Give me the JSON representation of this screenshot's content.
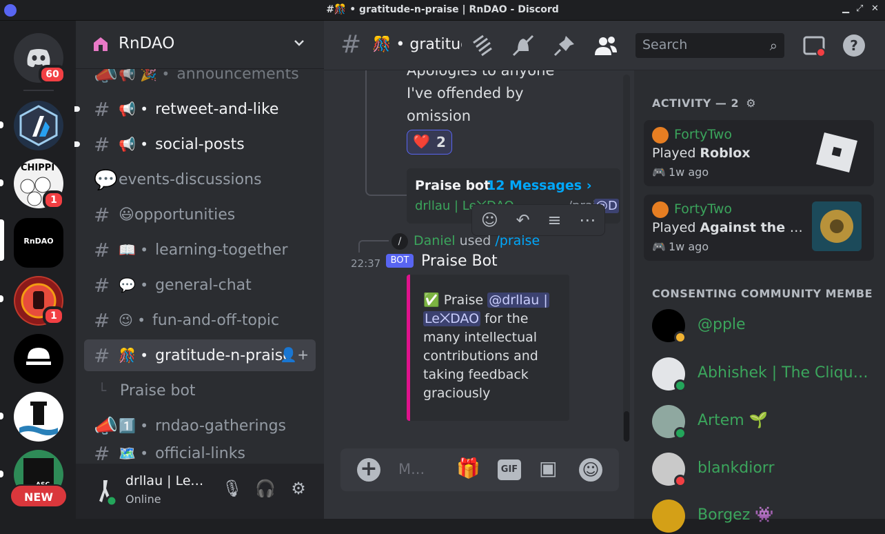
{
  "window": {
    "title": "#🎊 • gratitude-n-praise | RnDAO - Discord"
  },
  "guilds": {
    "home_badge": "60",
    "badges": [
      "1",
      "1"
    ],
    "rndao_label": "RnDAO",
    "new_label": "NEW",
    "chippi_label": "CHIPPI",
    "asc_label": "ASC"
  },
  "server": {
    "name": "RnDAO"
  },
  "channels": [
    {
      "prefix": "📢 🎉 •",
      "name": "announcements"
    },
    {
      "prefix": "📢 •",
      "name": "retweet-and-like"
    },
    {
      "prefix": "📢 •",
      "name": "social-posts"
    },
    {
      "prefix": "",
      "name": "events-discussions"
    },
    {
      "prefix": "😃",
      "name": "opportunities"
    },
    {
      "prefix": "📖 •",
      "name": "learning-together"
    },
    {
      "prefix": "💬 •",
      "name": "general-chat"
    },
    {
      "prefix": "😉 •",
      "name": "fun-and-off-topic"
    },
    {
      "prefix": "🎊 •",
      "name": "gratitude-n-praise"
    },
    {
      "prefix": "",
      "name": "Praise bot"
    },
    {
      "prefix": "1️⃣ •",
      "name": "rndao-gatherings"
    },
    {
      "prefix": "🗺️ •",
      "name": "official-links"
    }
  ],
  "user": {
    "name": "drllau | Lex...",
    "status": "Online"
  },
  "topbar": {
    "channel_title": "🎊 • gratitud",
    "search_placeholder": "Search"
  },
  "messages": {
    "prev_lines": [
      "Apologies to anyone",
      "I've offended by",
      "omission"
    ],
    "reaction": {
      "emoji": "❤️",
      "count": "2"
    },
    "thread": {
      "name": "Praise bot",
      "count": "12 Messages ›",
      "preview_user": "drllau | Le⨉DAO",
      "preview_text": "/prai",
      "preview_mention": "@D"
    },
    "command": {
      "user": "Daniel",
      "used": "used",
      "command": "/praise"
    },
    "time": "22:37",
    "bot_tag": "BOT",
    "author": "Praise Bot",
    "embed": {
      "check": "✅",
      "praise_word": "Praise",
      "mention1": "@drllau |",
      "mention2": "Le⨉DAO",
      "text": "for the many intellectual contributions and taking feedback graciously"
    }
  },
  "composer": {
    "placeholder": "M...",
    "gif": "GIF"
  },
  "members": {
    "activity_header": "ACTIVITY — 2",
    "activities": [
      {
        "user": "FortyTwo",
        "played": "Played",
        "game": "Roblox",
        "ago": "1w ago"
      },
      {
        "user": "FortyTwo",
        "played": "Played",
        "game": "Against the Sto...",
        "ago": "1w ago"
      }
    ],
    "section_header": "CONSENTING COMMUNITY MEMBE...",
    "list": [
      {
        "name": "@pple"
      },
      {
        "name": "Abhishek | The Clique ..."
      },
      {
        "name": "Artem 🌱"
      },
      {
        "name": "blankdiorr"
      },
      {
        "name": "Borgez 👾"
      }
    ]
  }
}
